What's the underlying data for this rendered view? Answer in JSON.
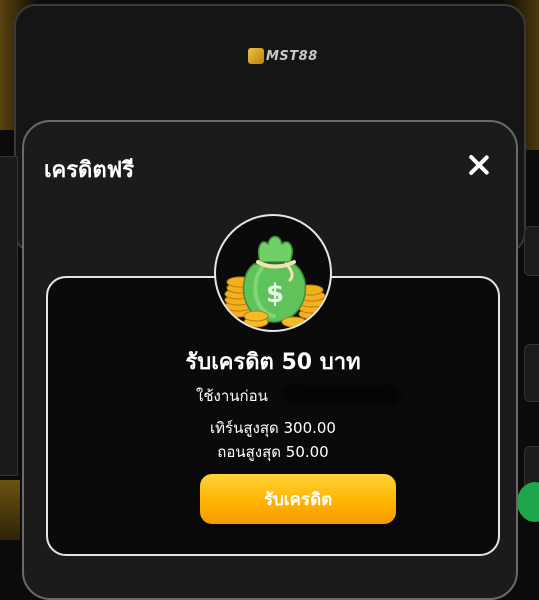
{
  "background": {
    "logo_text": "MST88",
    "accent_gold": "#ffb400",
    "accent_green": "#1fa64a"
  },
  "modal": {
    "title": "เครดิตฟรี",
    "close_icon": "close-icon",
    "reward": {
      "icon": "money-bag-icon",
      "title": "รับเครดิต 50 บาท",
      "use_before_label": "ใช้งานก่อน",
      "turnover": "เทิร์นสูงสุด 300.00",
      "withdraw": "ถอนสูงสุด 50.00",
      "claim_label": "รับเครดิต"
    },
    "colors": {
      "modal_bg": "#1b1b1b",
      "card_border": "#e6e6e6",
      "button_gold": "#ffb400"
    }
  }
}
